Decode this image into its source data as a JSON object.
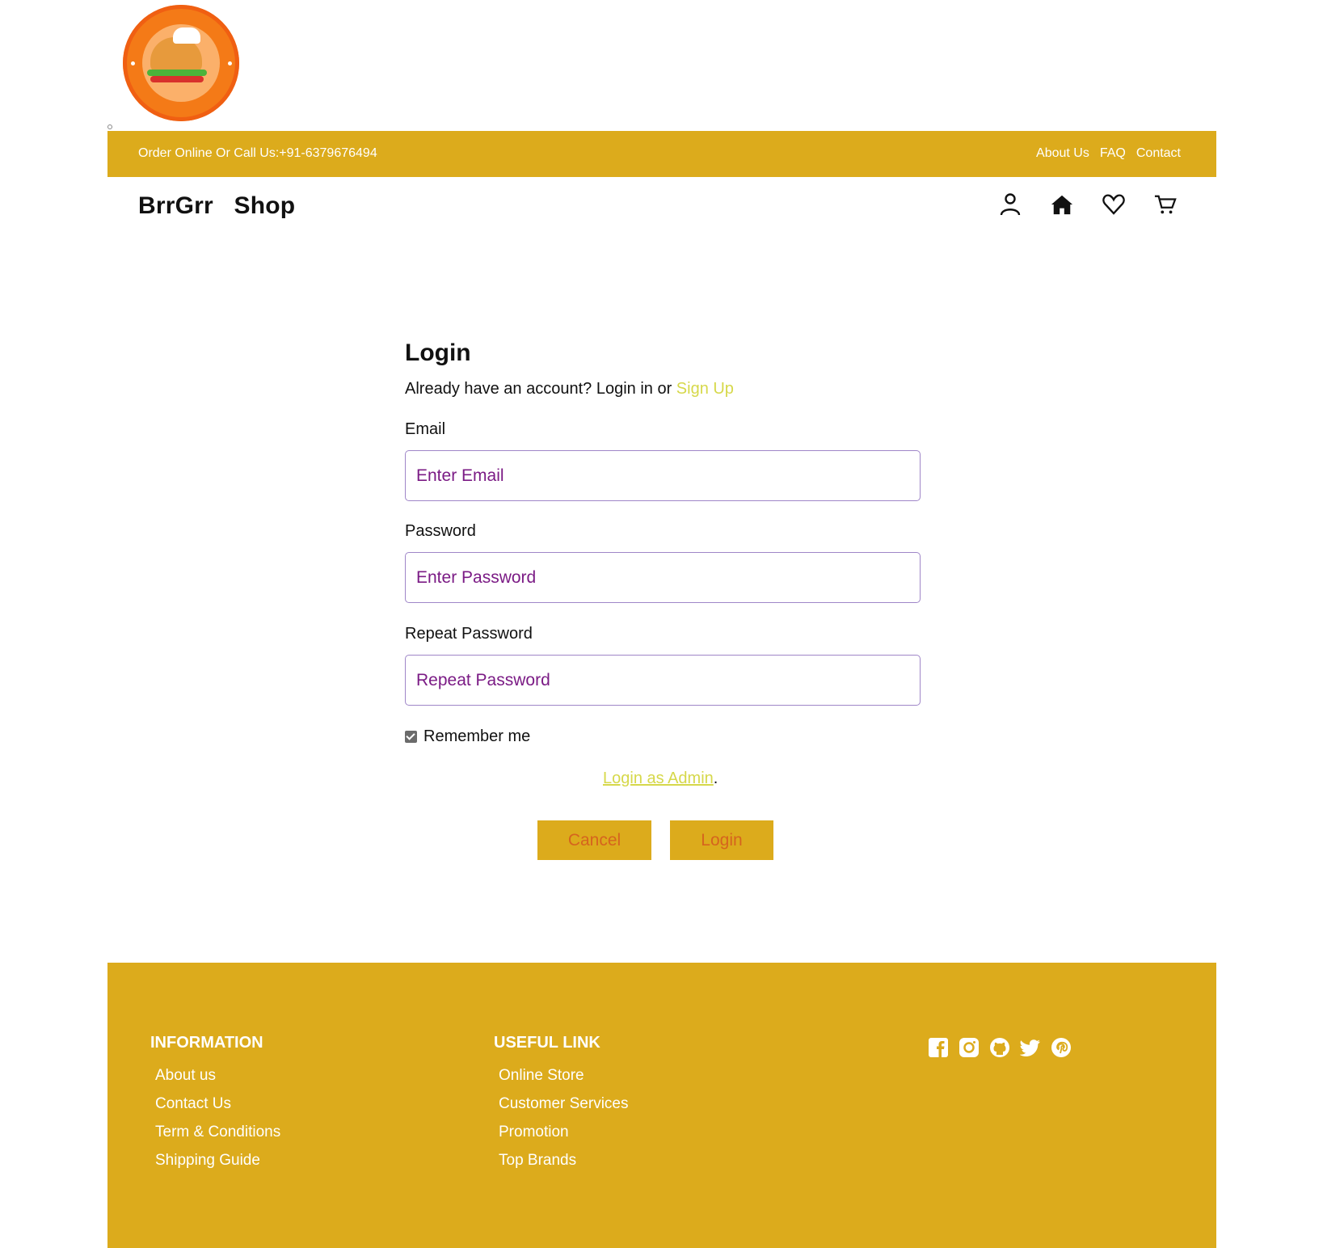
{
  "header": {
    "contact_text": "Order Online Or Call Us:+91-6379676494",
    "links": [
      "About Us",
      "FAQ",
      "Contact"
    ],
    "brand": "BrrGrr   Shop"
  },
  "nav_icons": [
    "user-icon",
    "home-icon",
    "heart-icon",
    "cart-icon"
  ],
  "login": {
    "title": "Login",
    "subtitle_prefix": "Already have an account? Login in or ",
    "signup_link": "Sign Up",
    "email_label": "Email",
    "email_placeholder": "Enter Email",
    "password_label": "Password",
    "password_placeholder": "Enter Password",
    "repeat_label": "Repeat Password",
    "repeat_placeholder": "Repeat Password",
    "remember_label": "Remember me",
    "remember_checked": true,
    "admin_link": "Login as Admin",
    "admin_suffix": ".",
    "cancel_label": "Cancel",
    "login_label": "Login"
  },
  "footer": {
    "info_title": "INFORMATION",
    "info_links": [
      "About us",
      "Contact Us",
      "Term & Conditions",
      "Shipping Guide"
    ],
    "useful_title": "USEFUL LINK",
    "useful_links": [
      "Online Store",
      "Customer Services",
      "Promotion",
      "Top Brands"
    ],
    "social": [
      "facebook-icon",
      "instagram-icon",
      "github-icon",
      "twitter-icon",
      "pinterest-icon"
    ]
  },
  "colors": {
    "accent": "#dcab1c",
    "link": "#d6d84a",
    "placeholder": "#7b1b85",
    "button_text": "#d5641e"
  }
}
